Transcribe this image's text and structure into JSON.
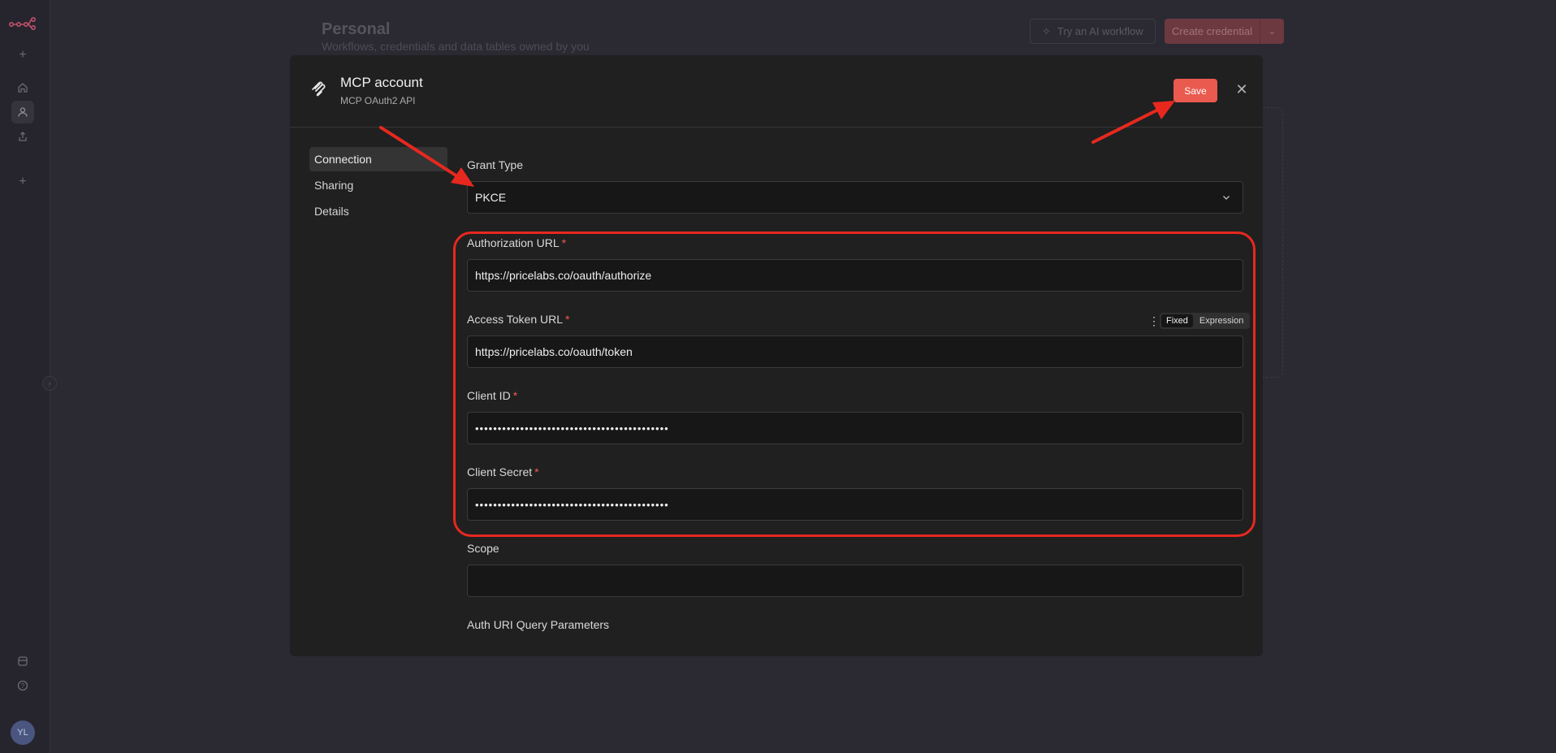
{
  "background": {
    "title": "Personal",
    "subtitle": "Workflows, credentials and data tables owned by you",
    "ai_button": "Try an AI workflow",
    "create_button": "Create credential"
  },
  "sidebar": {
    "avatar_initials": "YL",
    "icons": [
      "logo",
      "plus-icon",
      "home-icon",
      "user-icon",
      "share-icon",
      "plus-icon",
      "templates-icon",
      "help-icon"
    ]
  },
  "modal": {
    "title": "MCP account",
    "subtitle": "MCP OAuth2 API",
    "save_label": "Save",
    "close_glyph": "✕",
    "tabs": [
      {
        "label": "Connection",
        "active": true
      },
      {
        "label": "Sharing",
        "active": false
      },
      {
        "label": "Details",
        "active": false
      }
    ],
    "fields": {
      "grant_type": {
        "label": "Grant Type",
        "value": "PKCE"
      },
      "authorization_url": {
        "label": "Authorization URL",
        "value": "https://pricelabs.co/oauth/authorize",
        "required": "*"
      },
      "access_token_url": {
        "label": "Access Token URL",
        "value": "https://pricelabs.co/oauth/token",
        "required": "*",
        "mode_fixed": "Fixed",
        "mode_expression": "Expression"
      },
      "client_id": {
        "label": "Client ID",
        "value": "•••••••••••••••••••••••••••••••••••••••••••",
        "required": "*"
      },
      "client_secret": {
        "label": "Client Secret",
        "value": "•••••••••••••••••••••••••••••••••••••••••••",
        "required": "*"
      },
      "scope": {
        "label": "Scope",
        "value": ""
      },
      "auth_uri_query_params": {
        "label": "Auth URI Query Parameters"
      }
    }
  },
  "annotation_color": "#e8281f",
  "accent_color": "#ea5a4f"
}
